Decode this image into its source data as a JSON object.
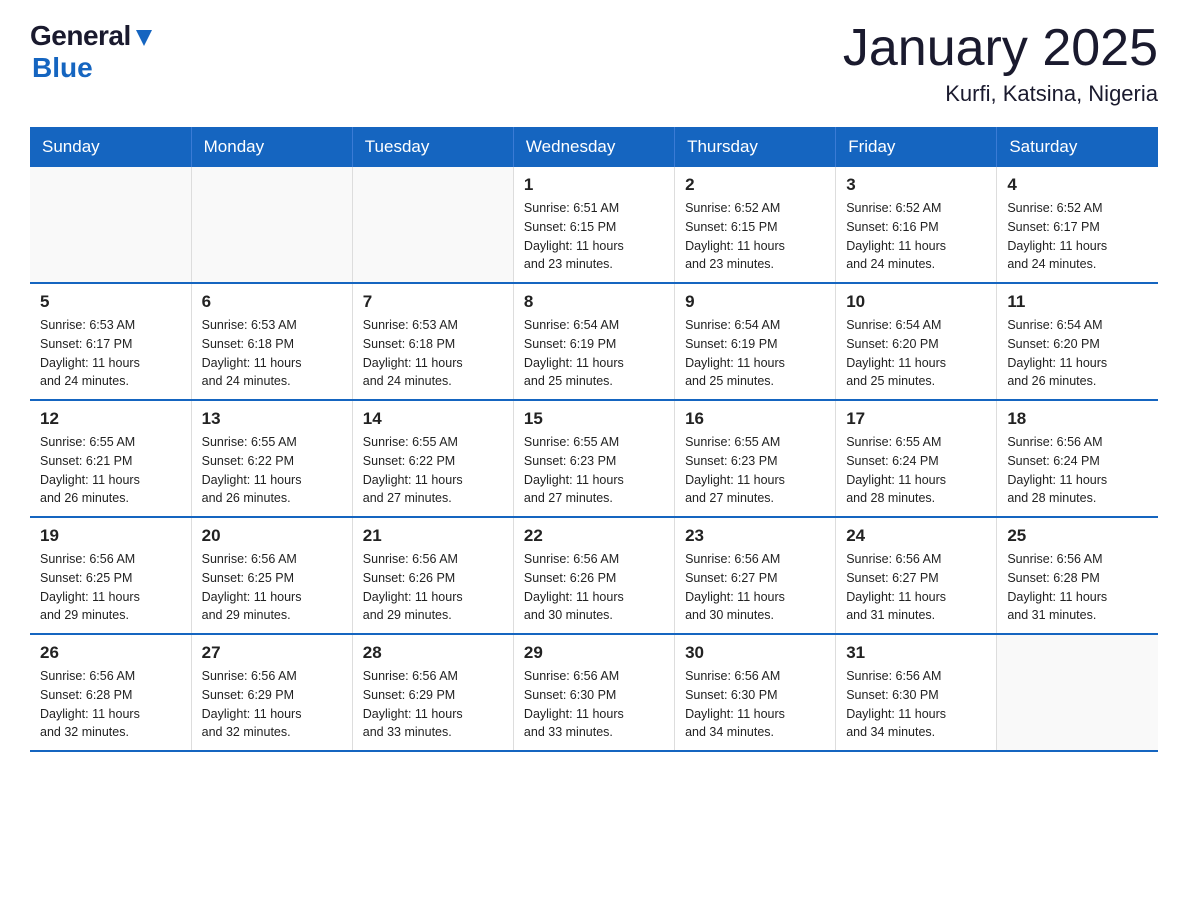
{
  "header": {
    "logo_general": "General",
    "logo_blue": "Blue",
    "title": "January 2025",
    "subtitle": "Kurfi, Katsina, Nigeria"
  },
  "days_of_week": [
    "Sunday",
    "Monday",
    "Tuesday",
    "Wednesday",
    "Thursday",
    "Friday",
    "Saturday"
  ],
  "weeks": [
    [
      {
        "day": "",
        "info": ""
      },
      {
        "day": "",
        "info": ""
      },
      {
        "day": "",
        "info": ""
      },
      {
        "day": "1",
        "info": "Sunrise: 6:51 AM\nSunset: 6:15 PM\nDaylight: 11 hours\nand 23 minutes."
      },
      {
        "day": "2",
        "info": "Sunrise: 6:52 AM\nSunset: 6:15 PM\nDaylight: 11 hours\nand 23 minutes."
      },
      {
        "day": "3",
        "info": "Sunrise: 6:52 AM\nSunset: 6:16 PM\nDaylight: 11 hours\nand 24 minutes."
      },
      {
        "day": "4",
        "info": "Sunrise: 6:52 AM\nSunset: 6:17 PM\nDaylight: 11 hours\nand 24 minutes."
      }
    ],
    [
      {
        "day": "5",
        "info": "Sunrise: 6:53 AM\nSunset: 6:17 PM\nDaylight: 11 hours\nand 24 minutes."
      },
      {
        "day": "6",
        "info": "Sunrise: 6:53 AM\nSunset: 6:18 PM\nDaylight: 11 hours\nand 24 minutes."
      },
      {
        "day": "7",
        "info": "Sunrise: 6:53 AM\nSunset: 6:18 PM\nDaylight: 11 hours\nand 24 minutes."
      },
      {
        "day": "8",
        "info": "Sunrise: 6:54 AM\nSunset: 6:19 PM\nDaylight: 11 hours\nand 25 minutes."
      },
      {
        "day": "9",
        "info": "Sunrise: 6:54 AM\nSunset: 6:19 PM\nDaylight: 11 hours\nand 25 minutes."
      },
      {
        "day": "10",
        "info": "Sunrise: 6:54 AM\nSunset: 6:20 PM\nDaylight: 11 hours\nand 25 minutes."
      },
      {
        "day": "11",
        "info": "Sunrise: 6:54 AM\nSunset: 6:20 PM\nDaylight: 11 hours\nand 26 minutes."
      }
    ],
    [
      {
        "day": "12",
        "info": "Sunrise: 6:55 AM\nSunset: 6:21 PM\nDaylight: 11 hours\nand 26 minutes."
      },
      {
        "day": "13",
        "info": "Sunrise: 6:55 AM\nSunset: 6:22 PM\nDaylight: 11 hours\nand 26 minutes."
      },
      {
        "day": "14",
        "info": "Sunrise: 6:55 AM\nSunset: 6:22 PM\nDaylight: 11 hours\nand 27 minutes."
      },
      {
        "day": "15",
        "info": "Sunrise: 6:55 AM\nSunset: 6:23 PM\nDaylight: 11 hours\nand 27 minutes."
      },
      {
        "day": "16",
        "info": "Sunrise: 6:55 AM\nSunset: 6:23 PM\nDaylight: 11 hours\nand 27 minutes."
      },
      {
        "day": "17",
        "info": "Sunrise: 6:55 AM\nSunset: 6:24 PM\nDaylight: 11 hours\nand 28 minutes."
      },
      {
        "day": "18",
        "info": "Sunrise: 6:56 AM\nSunset: 6:24 PM\nDaylight: 11 hours\nand 28 minutes."
      }
    ],
    [
      {
        "day": "19",
        "info": "Sunrise: 6:56 AM\nSunset: 6:25 PM\nDaylight: 11 hours\nand 29 minutes."
      },
      {
        "day": "20",
        "info": "Sunrise: 6:56 AM\nSunset: 6:25 PM\nDaylight: 11 hours\nand 29 minutes."
      },
      {
        "day": "21",
        "info": "Sunrise: 6:56 AM\nSunset: 6:26 PM\nDaylight: 11 hours\nand 29 minutes."
      },
      {
        "day": "22",
        "info": "Sunrise: 6:56 AM\nSunset: 6:26 PM\nDaylight: 11 hours\nand 30 minutes."
      },
      {
        "day": "23",
        "info": "Sunrise: 6:56 AM\nSunset: 6:27 PM\nDaylight: 11 hours\nand 30 minutes."
      },
      {
        "day": "24",
        "info": "Sunrise: 6:56 AM\nSunset: 6:27 PM\nDaylight: 11 hours\nand 31 minutes."
      },
      {
        "day": "25",
        "info": "Sunrise: 6:56 AM\nSunset: 6:28 PM\nDaylight: 11 hours\nand 31 minutes."
      }
    ],
    [
      {
        "day": "26",
        "info": "Sunrise: 6:56 AM\nSunset: 6:28 PM\nDaylight: 11 hours\nand 32 minutes."
      },
      {
        "day": "27",
        "info": "Sunrise: 6:56 AM\nSunset: 6:29 PM\nDaylight: 11 hours\nand 32 minutes."
      },
      {
        "day": "28",
        "info": "Sunrise: 6:56 AM\nSunset: 6:29 PM\nDaylight: 11 hours\nand 33 minutes."
      },
      {
        "day": "29",
        "info": "Sunrise: 6:56 AM\nSunset: 6:30 PM\nDaylight: 11 hours\nand 33 minutes."
      },
      {
        "day": "30",
        "info": "Sunrise: 6:56 AM\nSunset: 6:30 PM\nDaylight: 11 hours\nand 34 minutes."
      },
      {
        "day": "31",
        "info": "Sunrise: 6:56 AM\nSunset: 6:30 PM\nDaylight: 11 hours\nand 34 minutes."
      },
      {
        "day": "",
        "info": ""
      }
    ]
  ]
}
